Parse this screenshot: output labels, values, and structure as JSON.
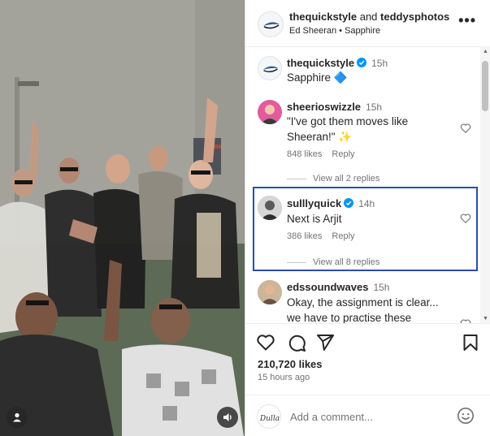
{
  "header": {
    "author1": "thequickstyle",
    "and_word": "and",
    "author2": "teddysphotos",
    "artist": "Ed Sheeran",
    "separator": "•",
    "song": "Sapphire",
    "more_label": "•••"
  },
  "caption": {
    "username": "thequickstyle",
    "time": "15h",
    "text": "Sapphire 🔷"
  },
  "comments": [
    {
      "username": "sheerioswizzle",
      "time": "15h",
      "text": "\"I've got them moves like Sheeran!\" ✨",
      "likes": "848 likes",
      "reply": "Reply",
      "view_replies": "View all 2 replies"
    },
    {
      "username": "sulllyquick",
      "time": "14h",
      "text": "Next is Arjit",
      "likes": "386 likes",
      "reply": "Reply",
      "view_replies": "View all 8 replies"
    },
    {
      "username": "edssoundwaves",
      "time": "15h",
      "text": "Okay, the assignment is clear... we have to practise these"
    }
  ],
  "footer": {
    "likes": "210,720 likes",
    "ago": "15 hours ago",
    "add_comment_placeholder": "Add a comment...",
    "commenter_avatar_text": "Dulla"
  },
  "colors": {
    "verified": "#0095f6",
    "highlight_border": "#2d4bb0"
  }
}
